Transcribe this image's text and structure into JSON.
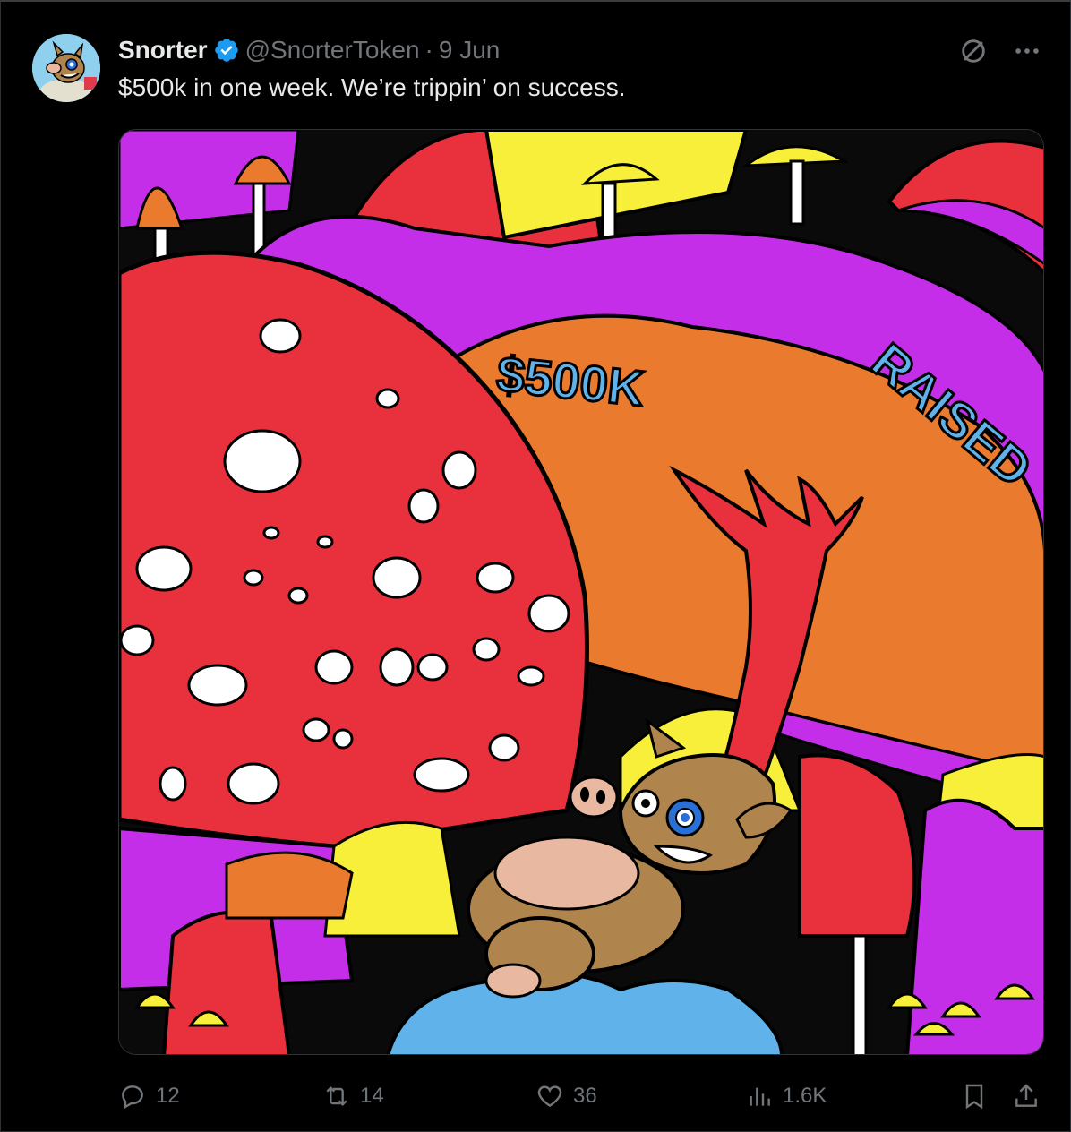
{
  "author": {
    "name": "Snorter",
    "handle": "@SnorterToken",
    "separator": "·",
    "date": "9 Jun",
    "verified": true
  },
  "tweet": {
    "text": "$500k in one week. We’re trippin’ on success."
  },
  "media": {
    "banner_text": "$500K RAISED",
    "description_icon": "psychedelic-mushroom-illustration"
  },
  "actions": {
    "replies": "12",
    "reposts": "14",
    "likes": "36",
    "views": "1.6K"
  },
  "colors": {
    "background": "#000000",
    "text_primary": "#e7e9ea",
    "text_secondary": "#71767b",
    "verified_blue": "#1d9bf0"
  },
  "icons": {
    "reply": "reply-icon",
    "repost": "repost-icon",
    "like": "heart-icon",
    "views": "views-icon",
    "bookmark": "bookmark-icon",
    "share": "share-icon",
    "grok": "grok-icon",
    "more": "more-icon"
  }
}
